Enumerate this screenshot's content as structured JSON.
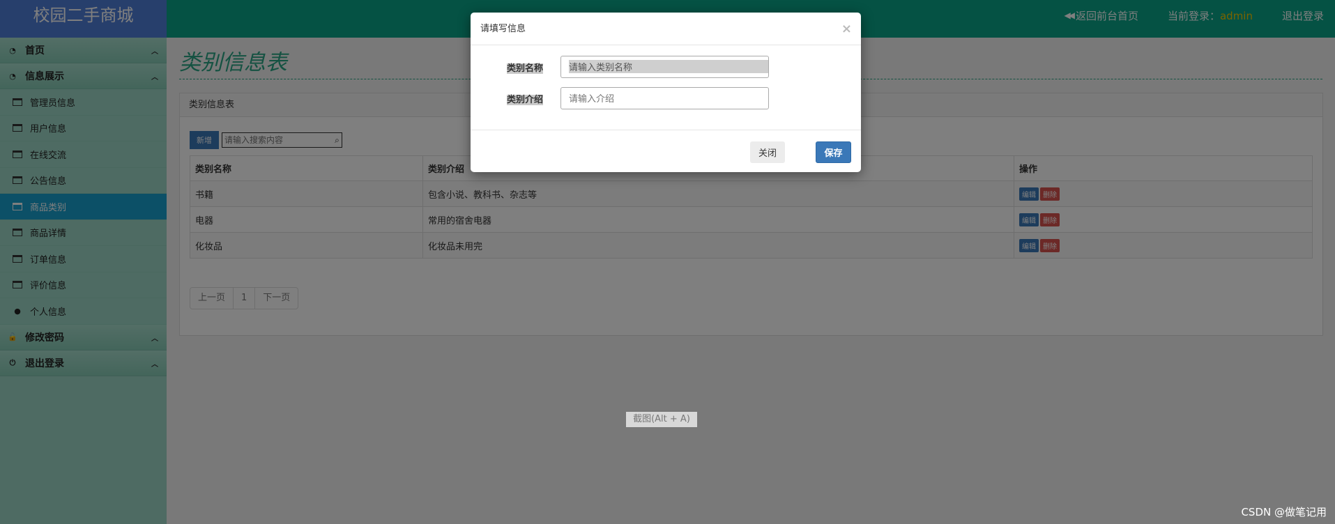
{
  "brand": "校园二手商城",
  "topbar": {
    "back_label": "返回前台首页",
    "login_label": "当前登录：",
    "username": "admin",
    "logout_label": "退出登录"
  },
  "sidebar": {
    "home": "首页",
    "info_group": "信息展示",
    "items": [
      "管理员信息",
      "用户信息",
      "在线交流",
      "公告信息",
      "商品类别",
      "商品详情",
      "订单信息",
      "评价信息",
      "个人信息"
    ],
    "active_index": 4,
    "change_pwd": "修改密码",
    "logout": "退出登录"
  },
  "main": {
    "title": "类别信息表",
    "panel_title": "类别信息表",
    "add_label": "新增",
    "search_placeholder": "请输入搜索内容",
    "columns": [
      "类别名称",
      "类别介绍",
      "操作"
    ],
    "rows": [
      {
        "name": "书籍",
        "desc": "包含小说、教科书、杂志等"
      },
      {
        "name": "电器",
        "desc": "常用的宿舍电器"
      },
      {
        "name": "化妆品",
        "desc": "化妆品未用完"
      }
    ],
    "edit_label": "编辑",
    "delete_label": "删除",
    "pager": {
      "prev": "上一页",
      "page": "1",
      "next": "下一页"
    }
  },
  "modal": {
    "title": "请填写信息",
    "close_x": "×",
    "name_label": "类别名称",
    "name_placeholder": "请输入类别名称",
    "desc_label": "类别介绍",
    "desc_placeholder": "请输入介绍",
    "close_button": "关闭",
    "save_button": "保存"
  },
  "tip": "截图(Alt + A)",
  "watermark": "CSDN @做笔记用",
  "colors": {
    "brand_bg": "#4f7ed8",
    "topbar_bg": "#0aa489",
    "active_item": "#18a1cf",
    "primary_btn": "#3a78b8",
    "danger_btn": "#d9534f"
  }
}
